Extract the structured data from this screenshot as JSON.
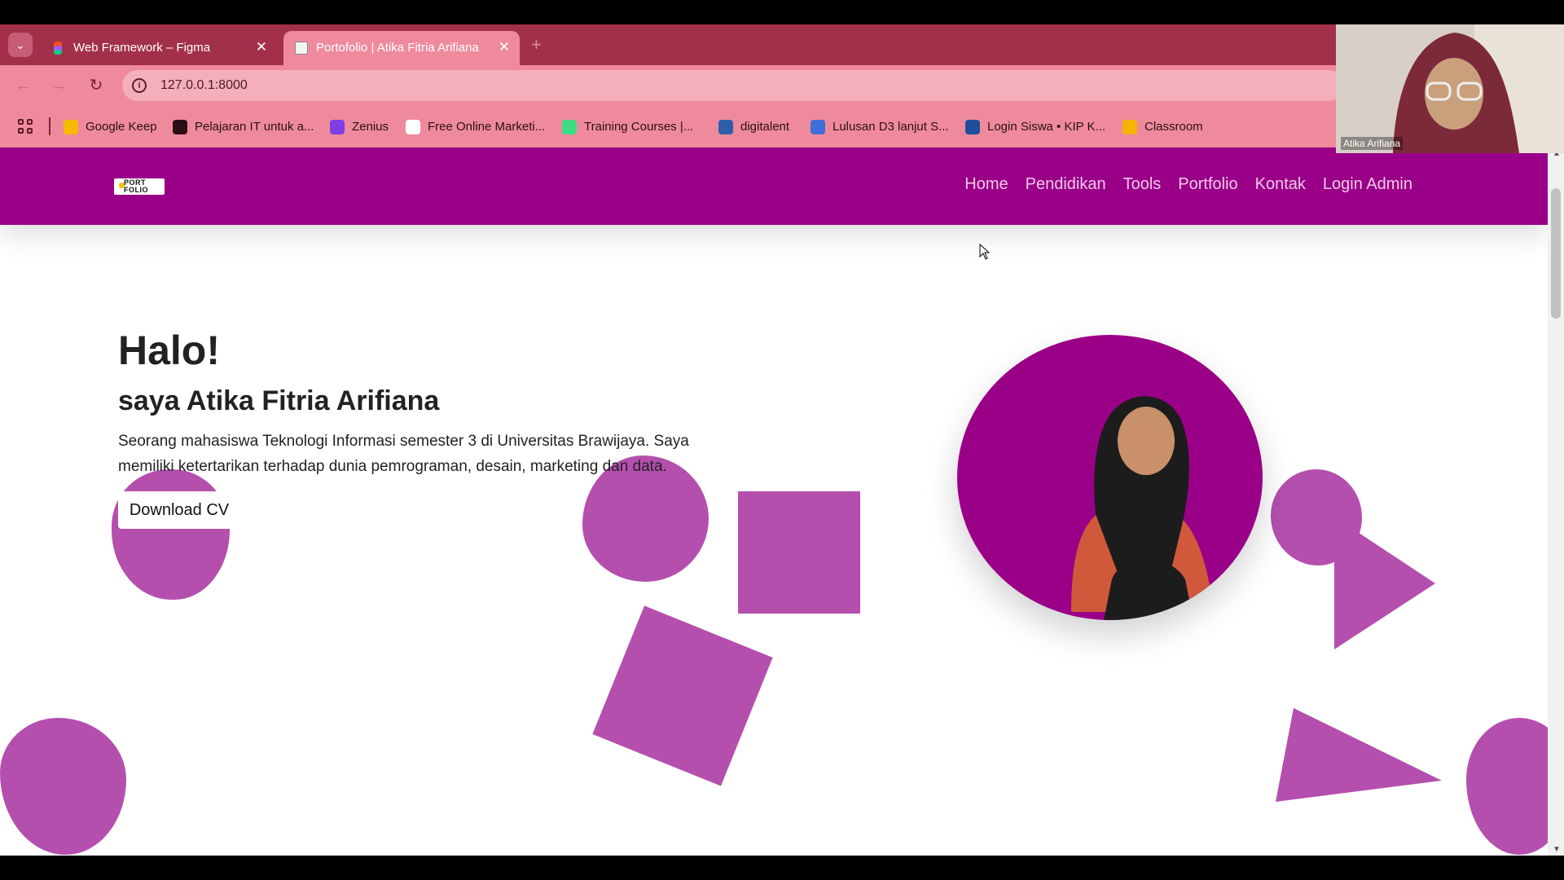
{
  "browser": {
    "tabs": [
      {
        "title": "Web Framework – Figma",
        "active": false
      },
      {
        "title": "Portofolio | Atika Fitria Arifiana",
        "active": true
      }
    ],
    "url": "127.0.0.1:8000",
    "bookmarks": [
      {
        "label": "Google Keep",
        "icon": "google-keep-icon",
        "color": "#f6bb00"
      },
      {
        "label": "Pelajaran IT untuk a...",
        "icon": "globe-icon",
        "color": "#2b0f15"
      },
      {
        "label": "Zenius",
        "icon": "zenius-icon",
        "color": "#7b3fe4"
      },
      {
        "label": "Free Online Marketi...",
        "icon": "google-icon",
        "color": "#ffffff"
      },
      {
        "label": "Training Courses |...",
        "icon": "android-icon",
        "color": "#3ddc84"
      },
      {
        "label": "digitalent",
        "icon": "digitalent-icon",
        "color": "#2e5ea8"
      },
      {
        "label": "Lulusan D3 lanjut S...",
        "icon": "link-icon",
        "color": "#3e6fd8"
      },
      {
        "label": "Login Siswa • KIP K...",
        "icon": "kemdikbud-icon",
        "color": "#1f4e9a"
      },
      {
        "label": "Classroom",
        "icon": "classroom-icon",
        "color": "#f5b400"
      }
    ]
  },
  "site": {
    "nav": [
      "Home",
      "Pendidikan",
      "Tools",
      "Portfolio",
      "Kontak",
      "Login Admin"
    ],
    "logo_text": "PORT FOLIO",
    "hero": {
      "greeting": "Halo!",
      "name": "saya Atika Fitria Arifiana",
      "description": "Seorang mahasiswa Teknologi Informasi semester 3 di Universitas Brawijaya. Saya memiliki ketertarikan terhadap dunia pemrograman, desain, marketing dan data.",
      "cta": "Download CV"
    }
  },
  "video_call": {
    "participant": "Atika Arifiana"
  },
  "colors": {
    "nav_bg": "#990087",
    "shape": "#b44fae",
    "tabbar": "#a3304a",
    "chrome": "#ef8a9d"
  }
}
